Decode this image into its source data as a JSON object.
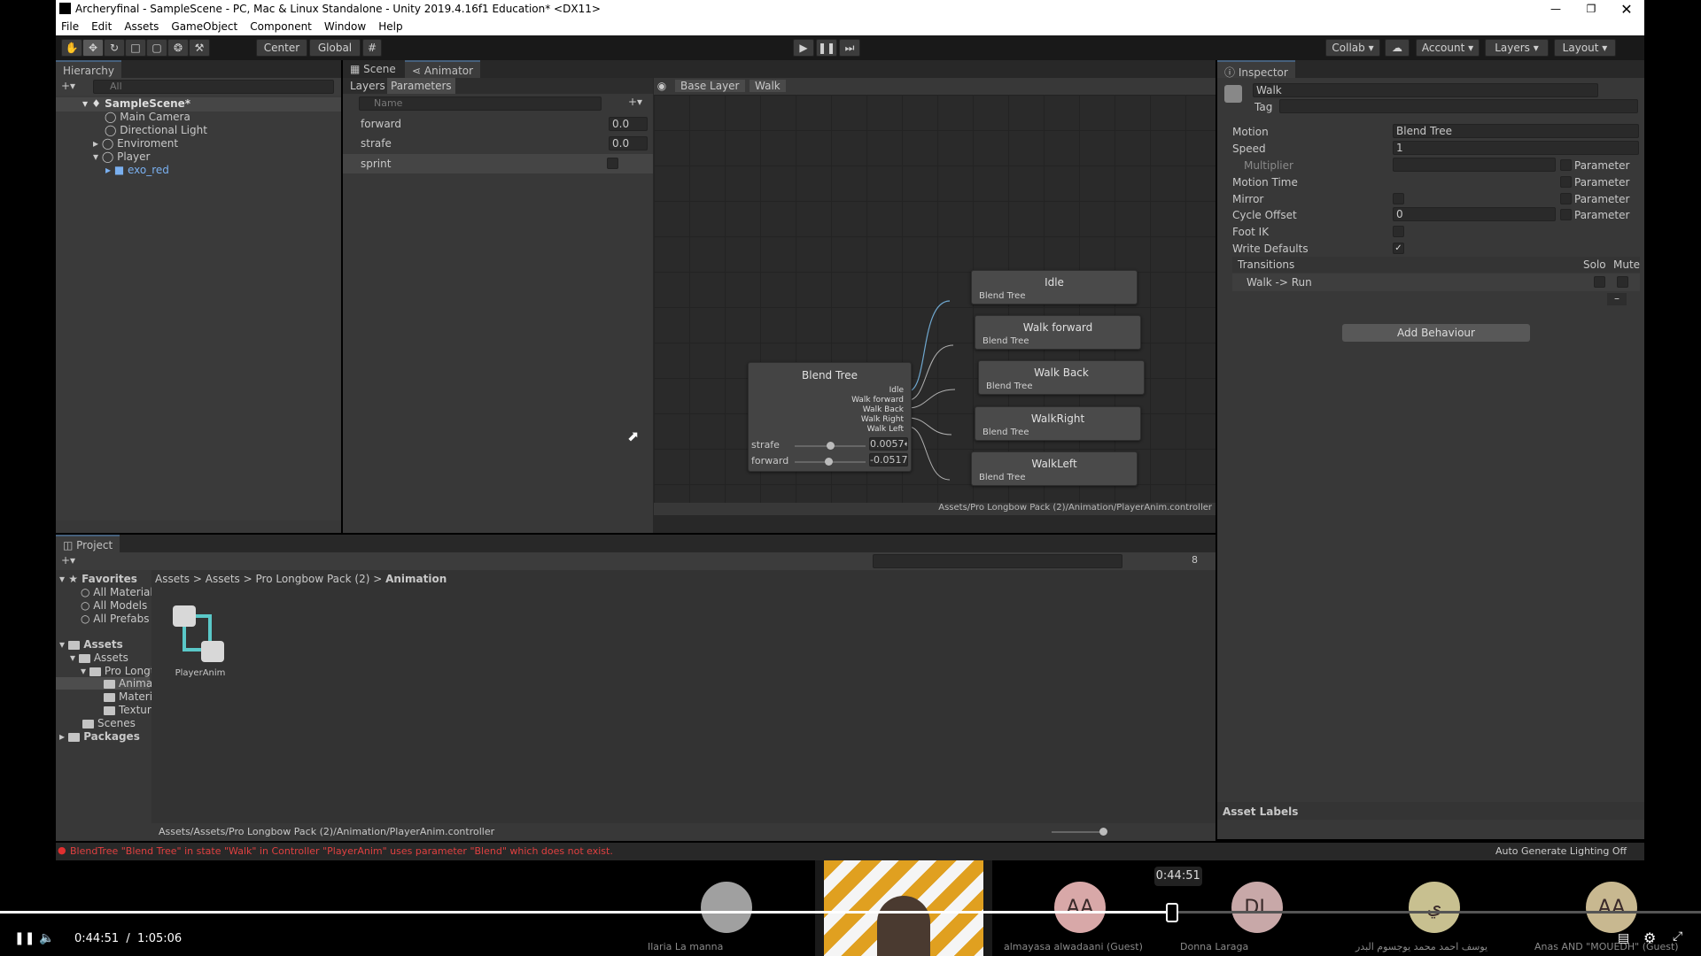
{
  "window": {
    "title": "Archeryfinal - SampleScene - PC, Mac & Linux Standalone - Unity 2019.4.16f1 Education* <DX11>"
  },
  "menu": [
    "File",
    "Edit",
    "Assets",
    "GameObject",
    "Component",
    "Window",
    "Help"
  ],
  "toolbar": {
    "center": "Center",
    "global": "Global",
    "collab": "Collab",
    "account": "Account",
    "layers": "Layers",
    "layout": "Layout"
  },
  "hierarchy": {
    "tab": "Hierarchy",
    "search_placeholder": "All",
    "items": [
      "SampleScene*",
      "Main Camera",
      "Directional Light",
      "Enviroment",
      "Player",
      "exo_red"
    ]
  },
  "animator": {
    "tabs": [
      "Scene",
      "Animator"
    ],
    "subtabs": [
      "Layers",
      "Parameters"
    ],
    "search_placeholder": "Name",
    "breadcrumb": [
      "Base Layer",
      "Walk"
    ],
    "params": [
      {
        "name": "forward",
        "value": "0.0"
      },
      {
        "name": "strafe",
        "value": "0.0"
      },
      {
        "name": "sprint",
        "value": ""
      }
    ],
    "blend": {
      "title": "Blend Tree",
      "outputs": [
        "Idle",
        "Walk forward",
        "Walk Back",
        "Walk Right",
        "Walk Left"
      ],
      "sliders": [
        {
          "name": "strafe",
          "value": "0.0057←",
          "level": 0.5
        },
        {
          "name": "forward",
          "value": "-0.0517",
          "level": 0.48
        }
      ]
    },
    "nodes": [
      {
        "title": "Idle",
        "sub": "Blend Tree"
      },
      {
        "title": "Walk forward",
        "sub": "Blend Tree"
      },
      {
        "title": "Walk Back",
        "sub": "Blend Tree"
      },
      {
        "title": "WalkRight",
        "sub": "Blend Tree"
      },
      {
        "title": "WalkLeft",
        "sub": "Blend Tree"
      }
    ],
    "path": "Assets/Pro Longbow Pack (2)/Animation/PlayerAnim.controller"
  },
  "inspector": {
    "tab": "Inspector",
    "name": "Walk",
    "tag": "Tag",
    "fields": {
      "motion_label": "Motion",
      "motion_value": "Blend Tree",
      "speed_label": "Speed",
      "speed_value": "1",
      "multiplier_label": "Multiplier",
      "motion_time_label": "Motion Time",
      "mirror_label": "Mirror",
      "cycle_offset_label": "Cycle Offset",
      "cycle_offset_value": "0",
      "foot_ik_label": "Foot IK",
      "write_defaults_label": "Write Defaults",
      "parameter": "Parameter"
    },
    "transitions_label": "Transitions",
    "solo": "Solo",
    "mute": "Mute",
    "transition": "Walk -> Run",
    "add_behaviour": "Add Behaviour",
    "asset_labels": "Asset Labels"
  },
  "project": {
    "tab": "Project",
    "favorites": [
      "Favorites",
      "All Materials",
      "All Models",
      "All Prefabs"
    ],
    "tree": [
      "Assets",
      "Assets",
      "Pro Longt",
      "Animat",
      "Materi",
      "Textur",
      "Scenes",
      "Packages"
    ],
    "breadcrumb": [
      "Assets",
      "Assets",
      "Pro Longbow Pack (2)",
      "Animation"
    ],
    "asset": "PlayerAnim",
    "footer_path": "Assets/Assets/Pro Longbow Pack (2)/Animation/PlayerAnim.controller",
    "hidden_count": "8"
  },
  "status": {
    "error": "BlendTree \"Blend Tree\" in state \"Walk\" in Controller \"PlayerAnim\" uses parameter \"Blend\" which does not exist.",
    "lighting": "Auto Generate Lighting Off"
  },
  "video": {
    "current": "0:44:51",
    "separator": "/",
    "total": "1:05:06",
    "tooltip": "0:44:51",
    "progress": 0.6889,
    "participants": [
      {
        "initials": "",
        "name": "Ilaria  La manna",
        "color": "#a0a0a0"
      },
      {
        "initials": "AA",
        "name": "almayasa alwadaani (Guest)",
        "color": "#d8a8a8"
      },
      {
        "initials": "DL",
        "name": "Donna Laraga",
        "color": "#c8a8a8"
      },
      {
        "initials": "ي",
        "name": "يوسف احمد محمد يوجسوم البدر",
        "color": "#c8c090"
      },
      {
        "initials": "AA",
        "name": "Anas AND \"MOUEDH\" (Guest)",
        "color": "#c8b890"
      }
    ]
  }
}
